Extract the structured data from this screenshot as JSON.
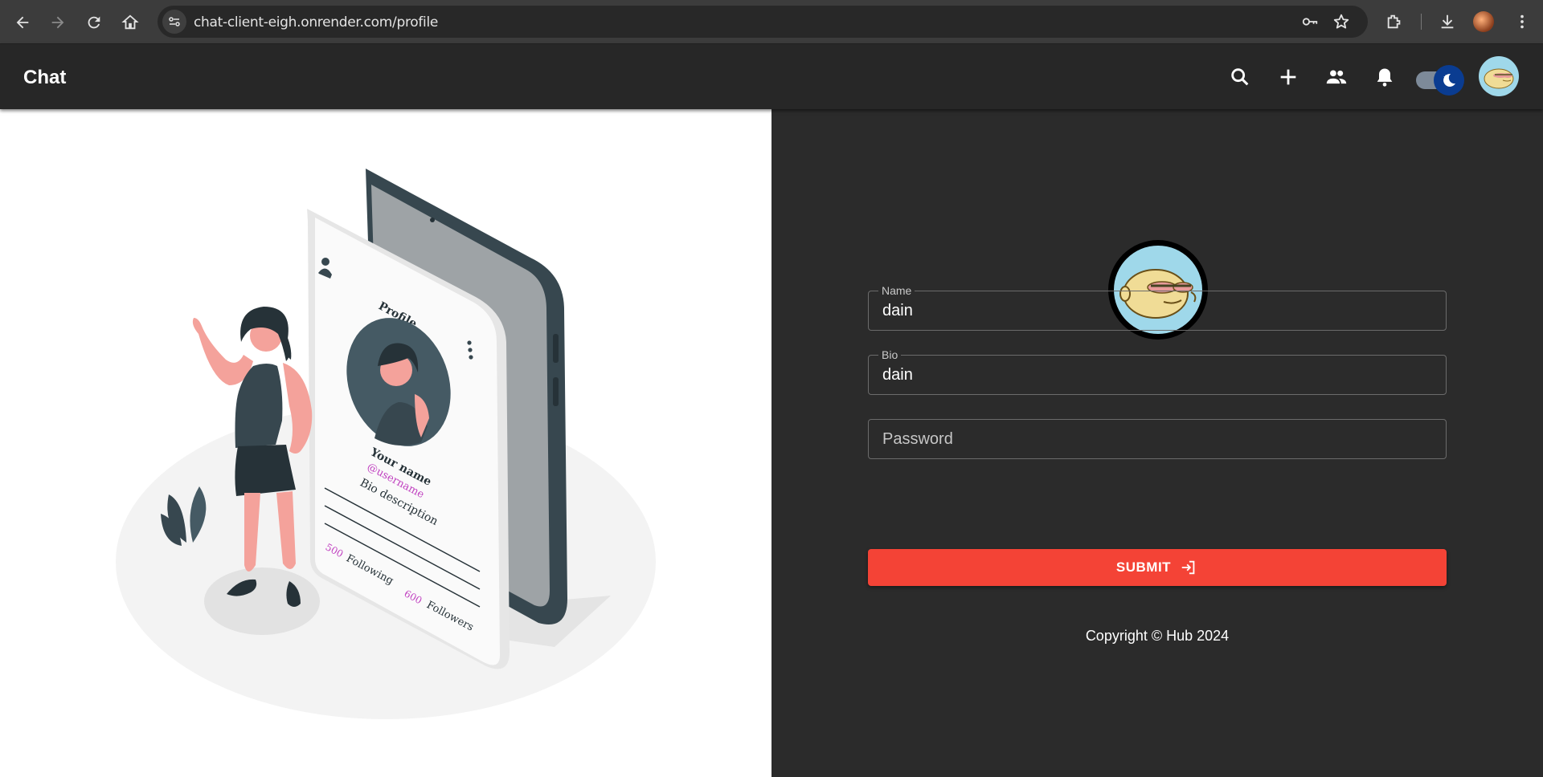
{
  "browser": {
    "url": "chat-client-eigh.onrender.com/profile"
  },
  "app_bar": {
    "title": "Chat",
    "icons": [
      "search-icon",
      "add-icon",
      "people-icon",
      "notifications-icon",
      "dark-mode-toggle",
      "user-avatar"
    ]
  },
  "illustration": {
    "profile_title": "Profile",
    "your_name": "Your name",
    "username": "@username",
    "bio": "Bio description",
    "following_count": "500",
    "following_label": "Following",
    "followers_count": "600",
    "followers_label": "Followers"
  },
  "form": {
    "name_label": "Name",
    "name_value": "dain",
    "bio_label": "Bio",
    "bio_value": "dain",
    "password_placeholder": "Password",
    "submit_label": "SUBMIT"
  },
  "footer": {
    "copyright": "Copyright © Hub 2024"
  },
  "colors": {
    "accent": "#f44336",
    "toggle_thumb": "#0a3c91",
    "avatar_bg": "#9fd8ea",
    "illustration_pink": "#c040c0"
  }
}
